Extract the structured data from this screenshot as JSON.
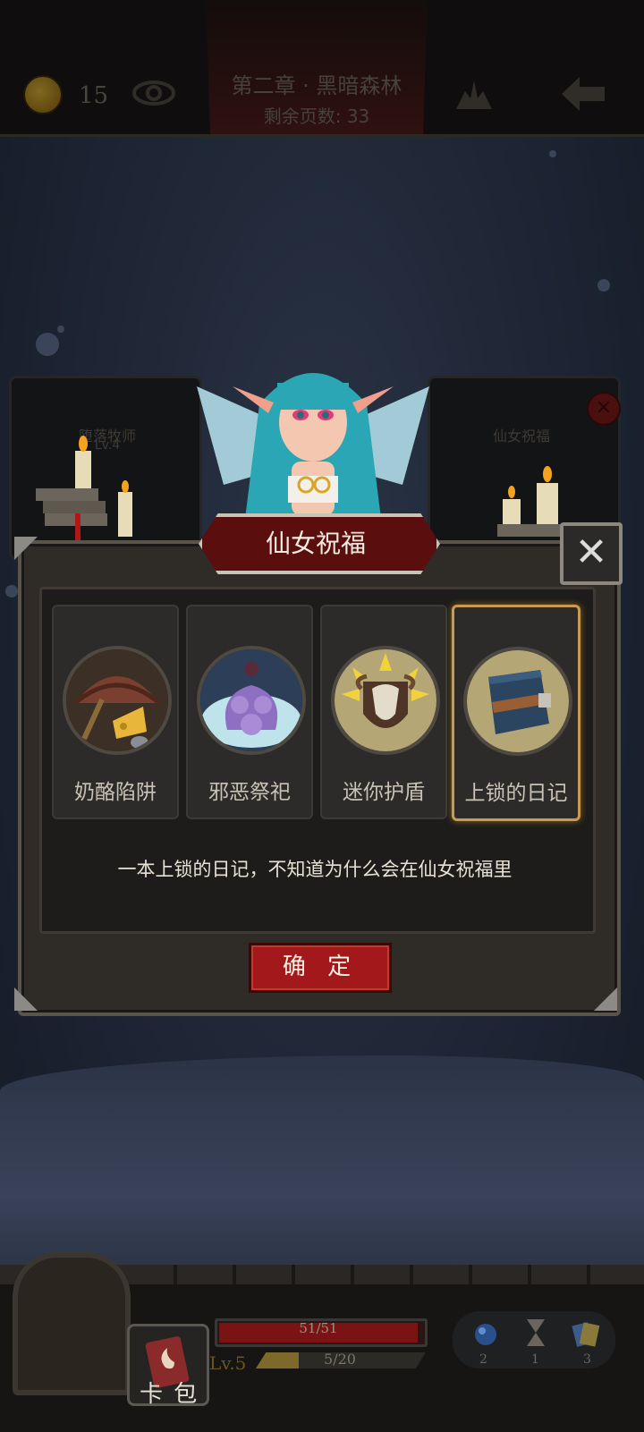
{
  "top_bar": {
    "coin_count": "15",
    "chapter_title": "第二章 · 黑暗森林",
    "pages_remaining": "剩余页数: 33",
    "icons": [
      "coin-icon",
      "eye-icon",
      "paw-icon",
      "back-arrow-icon"
    ]
  },
  "background_cards": {
    "left_title": "堕落牧师",
    "left_level": "Lv.4",
    "right_title": "仙女祝福"
  },
  "dialog": {
    "title": "仙女祝福",
    "options": [
      {
        "label": "奶酪陷阱",
        "icon": "cheese-trap-icon",
        "selected": false
      },
      {
        "label": "邪恶祭祀",
        "icon": "evil-ritual-icon",
        "selected": false
      },
      {
        "label": "迷你护盾",
        "icon": "mini-shield-icon",
        "selected": false
      },
      {
        "label": "上锁的日记",
        "icon": "locked-diary-icon",
        "selected": true
      }
    ],
    "description": "一本上锁的日记，不知道为什么会在仙女祝福里",
    "confirm_label": "确 定"
  },
  "bottom_bar": {
    "card_bag_label": "卡 包",
    "hp_text": "51/51",
    "hp_fraction": 1.0,
    "level_text": "Lv.5",
    "xp_text": "5/20",
    "xp_fraction": 0.25,
    "resources": [
      {
        "icon": "potion-icon",
        "count": "2"
      },
      {
        "icon": "hourglass-icon",
        "count": "1"
      },
      {
        "icon": "cards-icon",
        "count": "3"
      }
    ]
  }
}
